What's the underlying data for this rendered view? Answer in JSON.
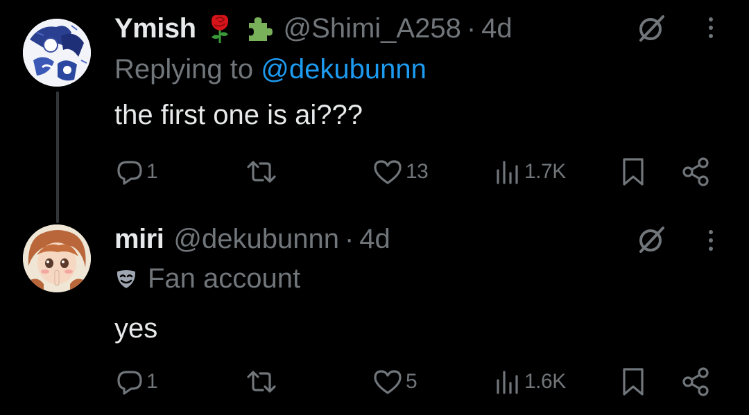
{
  "tweets": [
    {
      "display_name": "Ymish",
      "emoji_1": "rose-emoji",
      "emoji_2": "puzzle-piece-emoji",
      "handle": "@Shimi_A258",
      "separator": "·",
      "time": "4d",
      "replying_prefix": "Replying to ",
      "replying_to": "@dekubunnn",
      "text": "the first one is ai???",
      "actions": {
        "replies": "1",
        "retweets": "",
        "likes": "13",
        "views": "1.7K"
      }
    },
    {
      "display_name": "miri",
      "handle": "@dekubunnn",
      "separator": "·",
      "time": "4d",
      "badge": "Fan account",
      "badge_icon": "theater-mask-icon",
      "text": "yes",
      "actions": {
        "replies": "1",
        "retweets": "",
        "likes": "5",
        "views": "1.6K"
      }
    }
  ],
  "colors": {
    "background": "#000000",
    "primary_text": "#e7e9ea",
    "secondary_text": "#71767b",
    "link": "#1d9bf0",
    "thread_line": "#333639"
  }
}
